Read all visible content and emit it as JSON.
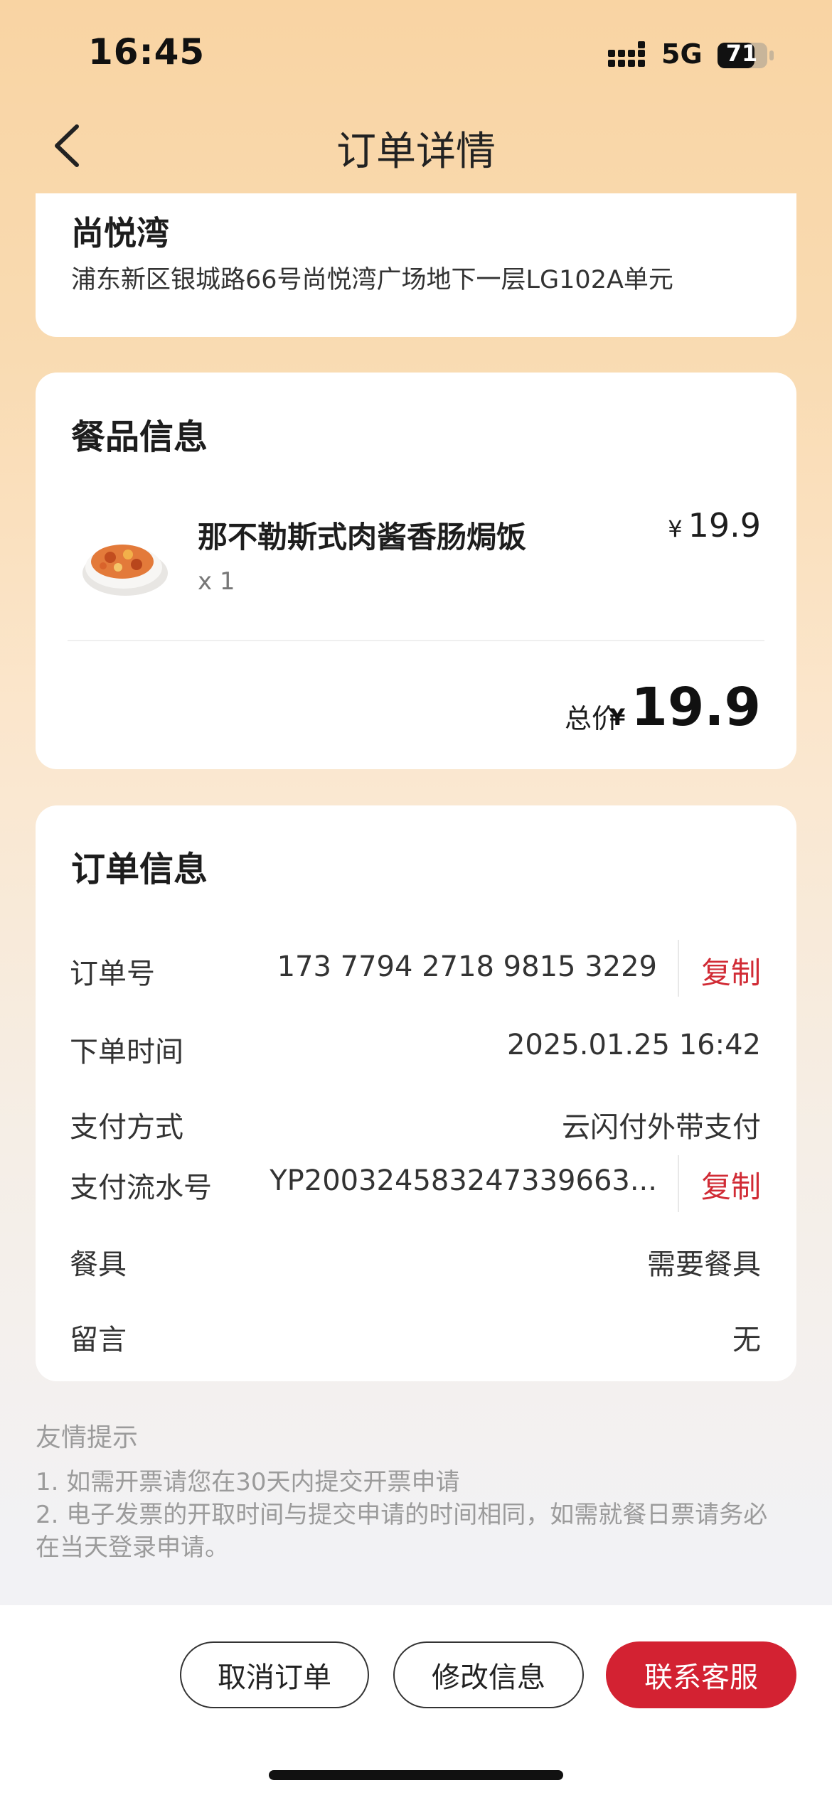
{
  "status_bar": {
    "time": "16:45",
    "network": "5G",
    "battery": "71"
  },
  "nav": {
    "title": "订单详情",
    "back_icon": "chevron-left-icon"
  },
  "store": {
    "name": "尚悦湾",
    "address": "浦东新区银城路66号尚悦湾广场地下一层LG102A单元"
  },
  "food_section": {
    "title": "餐品信息",
    "items": [
      {
        "name": "那不勒斯式肉酱香肠焗饭",
        "qty": "x 1",
        "currency": "¥",
        "price": "19.9"
      }
    ],
    "total_label": "总价",
    "total_currency": "¥",
    "total_value": "19.9"
  },
  "order_section": {
    "title": "订单信息",
    "rows": [
      {
        "label": "订单号",
        "value": "173 7794 2718 9815 3229",
        "action": "复制"
      },
      {
        "label": "下单时间",
        "value": "2025.01.25 16:42"
      },
      {
        "label": "支付方式",
        "value": "云闪付外带支付"
      },
      {
        "label": "支付流水号",
        "value": "YP20032458324733966​3...",
        "action": "复制"
      },
      {
        "label": "餐具",
        "value": "需要餐具"
      },
      {
        "label": "留言",
        "value": "无"
      }
    ]
  },
  "tips": {
    "title": "友情提示",
    "lines": [
      "1. 如需开票请您在30天内提交开票申请",
      "2. 电子发票的开取时间与提交申请的时间相同，如需就餐日票请务必在当天登录申请。"
    ]
  },
  "actions": {
    "cancel": "取消订单",
    "modify": "修改信息",
    "contact": "联系客服"
  },
  "colors": {
    "accent": "#d32232",
    "background_top": "#f9d4a3"
  }
}
